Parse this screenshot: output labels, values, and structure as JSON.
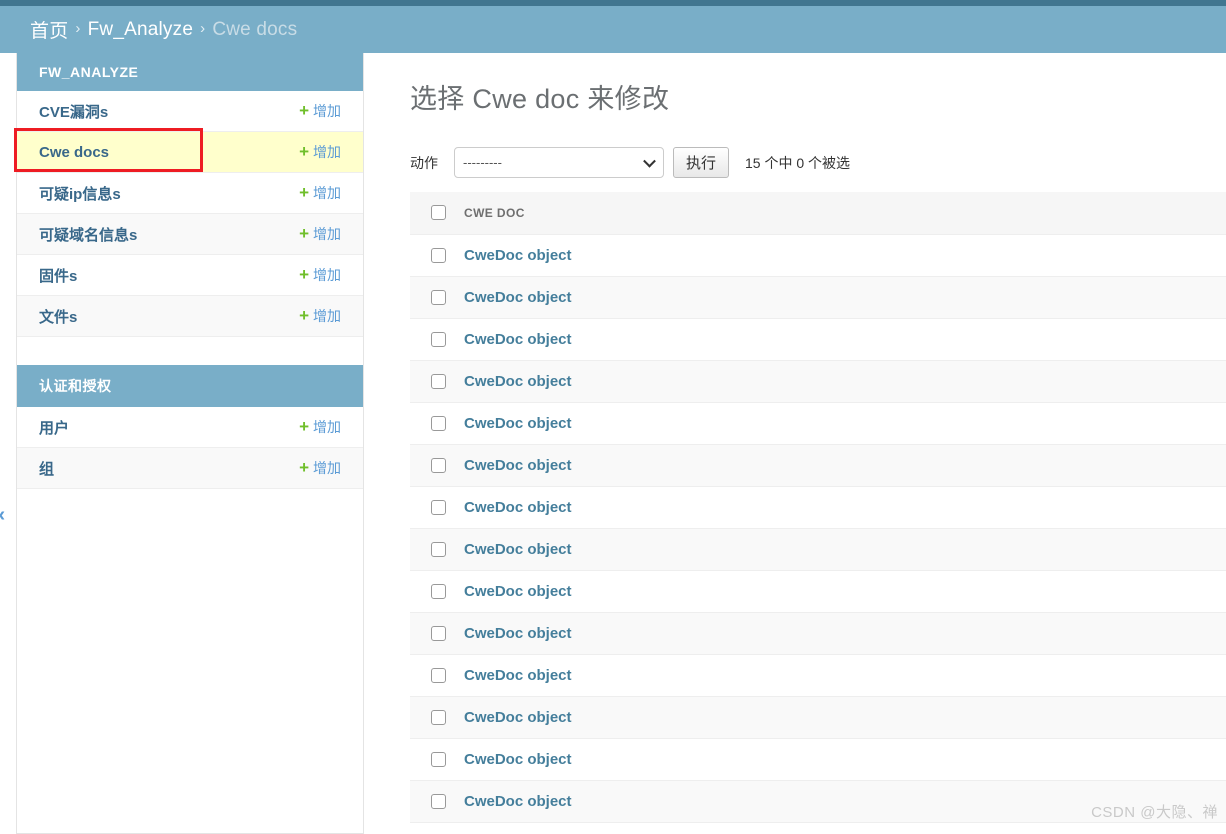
{
  "header": {
    "breadcrumb": [
      {
        "label": "首页",
        "link": true
      },
      {
        "label": "Fw_Analyze",
        "link": true
      },
      {
        "label": "Cwe docs",
        "link": false
      }
    ],
    "separator": "›"
  },
  "colors": {
    "brand_dark": "#417690",
    "brand": "#79aec8",
    "link": "#447e9b",
    "add_green": "#70bf2b",
    "highlight_row": "#ffffcc",
    "annotation_red": "#ee1c23"
  },
  "sidebar": {
    "toggle_icon": "«",
    "modules": [
      {
        "title": "FW_ANALYZE",
        "items": [
          {
            "label": "CVE漏洞s",
            "add_label": "增加",
            "add_icon": "+",
            "current": false
          },
          {
            "label": "Cwe docs",
            "add_label": "增加",
            "add_icon": "+",
            "current": true
          },
          {
            "label": "可疑ip信息s",
            "add_label": "增加",
            "add_icon": "+",
            "current": false
          },
          {
            "label": "可疑域名信息s",
            "add_label": "增加",
            "add_icon": "+",
            "current": false
          },
          {
            "label": "固件s",
            "add_label": "增加",
            "add_icon": "+",
            "current": false
          },
          {
            "label": "文件s",
            "add_label": "增加",
            "add_icon": "+",
            "current": false
          }
        ]
      },
      {
        "title": "认证和授权",
        "items": [
          {
            "label": "用户",
            "add_label": "增加",
            "add_icon": "+",
            "current": false
          },
          {
            "label": "组",
            "add_label": "增加",
            "add_icon": "+",
            "current": false
          }
        ]
      }
    ]
  },
  "main": {
    "title": "选择 Cwe doc 来修改",
    "action_bar": {
      "label": "动作",
      "select_value": "---------",
      "select_options": [
        "---------"
      ],
      "go_button": "执行",
      "selection_count": "15 个中 0 个被选"
    },
    "table": {
      "select_all_checkbox": "unchecked",
      "columns": [
        "CWE DOC"
      ],
      "rows": [
        {
          "name": "CweDoc object",
          "checked": false
        },
        {
          "name": "CweDoc object",
          "checked": false
        },
        {
          "name": "CweDoc object",
          "checked": false
        },
        {
          "name": "CweDoc object",
          "checked": false
        },
        {
          "name": "CweDoc object",
          "checked": false
        },
        {
          "name": "CweDoc object",
          "checked": false
        },
        {
          "name": "CweDoc object",
          "checked": false
        },
        {
          "name": "CweDoc object",
          "checked": false
        },
        {
          "name": "CweDoc object",
          "checked": false
        },
        {
          "name": "CweDoc object",
          "checked": false
        },
        {
          "name": "CweDoc object",
          "checked": false
        },
        {
          "name": "CweDoc object",
          "checked": false
        },
        {
          "name": "CweDoc object",
          "checked": false
        },
        {
          "name": "CweDoc object",
          "checked": false
        }
      ]
    }
  },
  "watermark": "CSDN @大隐、禅"
}
